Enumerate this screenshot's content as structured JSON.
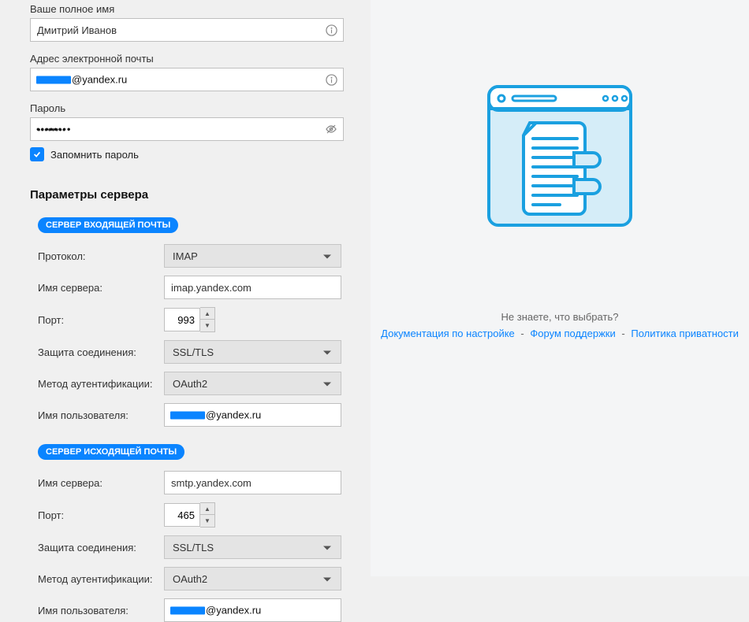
{
  "account": {
    "fullname_label": "Ваше полное имя",
    "fullname": "Дмитрий Иванов",
    "email_label": "Адрес электронной почты",
    "email_suffix": "@yandex.ru",
    "password_label": "Пароль",
    "password_masked": "••••••••",
    "remember_label": "Запомнить пароль",
    "remember_checked": true
  },
  "server_section_title": "Параметры сервера",
  "incoming_pill": "СЕРВЕР ВХОДЯЩЕЙ ПОЧТЫ",
  "outgoing_pill": "СЕРВЕР ИСХОДЯЩЕЙ ПОЧТЫ",
  "labels": {
    "protocol": "Протокол:",
    "server_name": "Имя сервера:",
    "port": "Порт:",
    "security": "Защита соединения:",
    "auth": "Метод аутентификации:",
    "username": "Имя пользователя:"
  },
  "incoming": {
    "protocol": "IMAP",
    "server": "imap.yandex.com",
    "port": "993",
    "security": "SSL/TLS",
    "auth": "OAuth2",
    "username_suffix": "@yandex.ru"
  },
  "outgoing": {
    "server": "smtp.yandex.com",
    "port": "465",
    "security": "SSL/TLS",
    "auth": "OAuth2",
    "username_suffix": "@yandex.ru"
  },
  "help": {
    "prompt": "Не знаете, что выбрать?",
    "link1": "Документация по настройке",
    "link2": "Форум поддержки",
    "link3": "Политика приватности",
    "sep": "-"
  }
}
